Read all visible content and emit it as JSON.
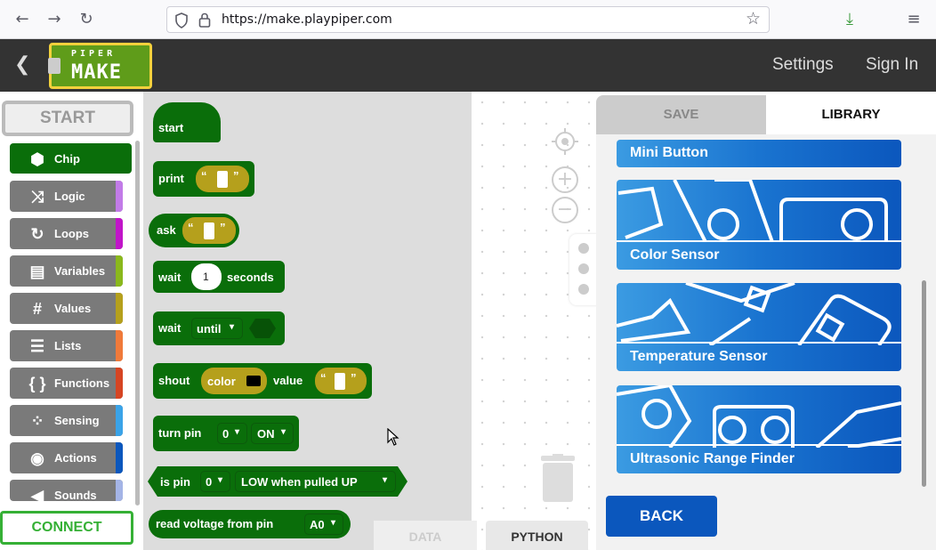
{
  "browser": {
    "url": "https://make.playpiper.com",
    "back_glyph": "←",
    "forward_glyph": "→",
    "reload_glyph": "↻",
    "bookmark_glyph": "☆",
    "download_glyph": "⤓",
    "menu_glyph": "≡"
  },
  "header": {
    "back_glyph": "❮",
    "logo_top": "PIPER",
    "logo_bottom": "MAKE",
    "settings_label": "Settings",
    "signin_label": "Sign In"
  },
  "sidebar": {
    "start_label": "START",
    "connect_label": "CONNECT",
    "categories": [
      {
        "label": "Chip",
        "icon": "hexagon-icon",
        "glyph": "⬢",
        "color": "#0a6e0a"
      },
      {
        "label": "Logic",
        "icon": "shuffle-icon",
        "glyph": "⤨",
        "color": "#c27be8"
      },
      {
        "label": "Loops",
        "icon": "loop-icon",
        "glyph": "↻",
        "color": "#c114c9"
      },
      {
        "label": "Variables",
        "icon": "variables-icon",
        "glyph": "▤",
        "color": "#8ab81c"
      },
      {
        "label": "Values",
        "icon": "hash-icon",
        "glyph": "#",
        "color": "#b5a01c"
      },
      {
        "label": "Lists",
        "icon": "list-icon",
        "glyph": "☰",
        "color": "#f07a3a"
      },
      {
        "label": "Functions",
        "icon": "braces-icon",
        "glyph": "{ }",
        "color": "#d64523"
      },
      {
        "label": "Sensing",
        "icon": "sensing-icon",
        "glyph": "⁘",
        "color": "#3aa3e8"
      },
      {
        "label": "Actions",
        "icon": "record-icon",
        "glyph": "◉",
        "color": "#0b57bd"
      },
      {
        "label": "Sounds",
        "icon": "speaker-icon",
        "glyph": "◀",
        "color": "#a4b4e6"
      }
    ]
  },
  "blocks": {
    "start": "start",
    "print": "print",
    "ask": "ask",
    "wait": "wait",
    "wait_value": "1",
    "seconds": "seconds",
    "wait2": "wait",
    "until": "until",
    "shout": "shout",
    "color": "color",
    "value": "value",
    "turn_pin": "turn pin",
    "pin_0": "0",
    "on": "ON",
    "is_pin": "is pin",
    "is_pin_0": "0",
    "low_when": "LOW when pulled UP",
    "read_voltage": "read voltage from pin",
    "a0": "A0",
    "quote_open": "“",
    "quote_close": "”",
    "caret": "▾"
  },
  "bottom_tabs": {
    "data": "DATA",
    "python": "PYTHON"
  },
  "library": {
    "tab_save": "SAVE",
    "tab_library": "LIBRARY",
    "cards": [
      "Mini Button",
      "Color Sensor",
      "Temperature Sensor",
      "Ultrasonic Range Finder"
    ],
    "back_label": "BACK"
  },
  "workspace": {
    "zoom_in": "+",
    "zoom_out": "−"
  }
}
